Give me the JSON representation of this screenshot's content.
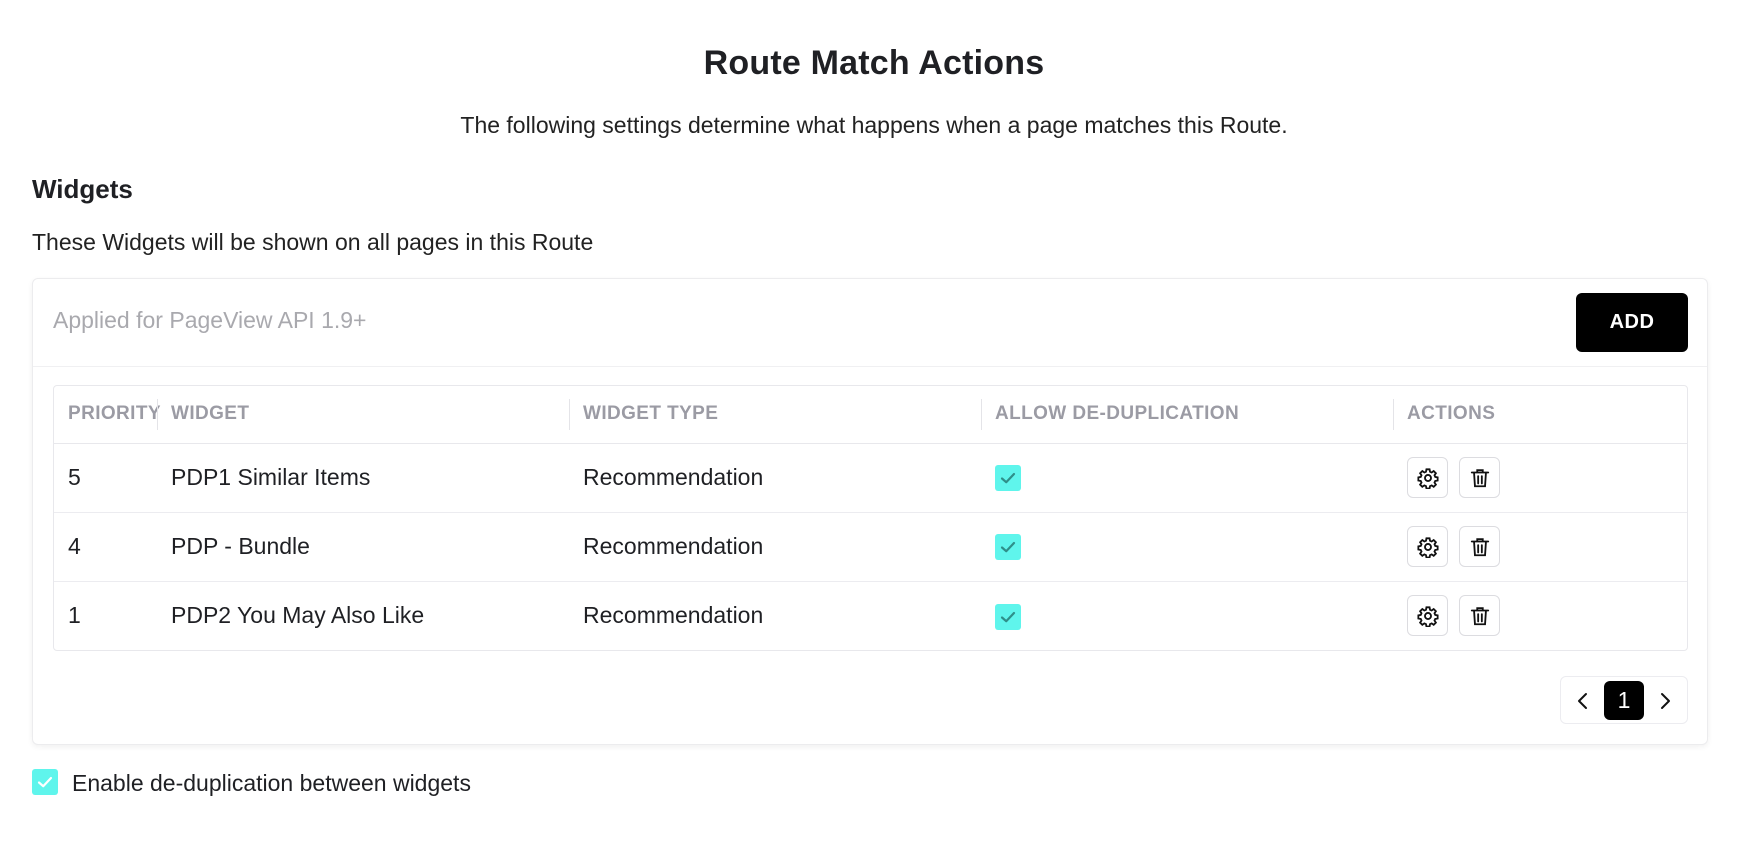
{
  "page": {
    "title": "Route Match Actions",
    "subtitle": "The following settings determine what happens when a page matches this Route."
  },
  "widgets_section": {
    "title": "Widgets",
    "description": "These Widgets will be shown on all pages in this Route",
    "card_header": "Applied for PageView API 1.9+",
    "add_label": "ADD",
    "columns": [
      "PRIORITY",
      "WIDGET",
      "WIDGET TYPE",
      "ALLOW DE-DUPLICATION",
      "ACTIONS"
    ],
    "rows": [
      {
        "priority": "5",
        "widget": "PDP1 Similar Items",
        "type": "Recommendation",
        "allow_dedup": true
      },
      {
        "priority": "4",
        "widget": "PDP - Bundle",
        "type": "Recommendation",
        "allow_dedup": true
      },
      {
        "priority": "1",
        "widget": "PDP2 You May Also Like",
        "type": "Recommendation",
        "allow_dedup": true
      }
    ],
    "pagination": {
      "current": "1"
    }
  },
  "footer": {
    "dedup_label": "Enable de-duplication between widgets",
    "dedup_checked": true
  },
  "colors": {
    "checkbox_fill": "#5ff5ec",
    "primary_button": "#000000"
  },
  "icons": {
    "settings": "gear-icon",
    "delete": "trash-icon",
    "check": "check-icon",
    "prev": "chevron-left-icon",
    "next": "chevron-right-icon"
  }
}
